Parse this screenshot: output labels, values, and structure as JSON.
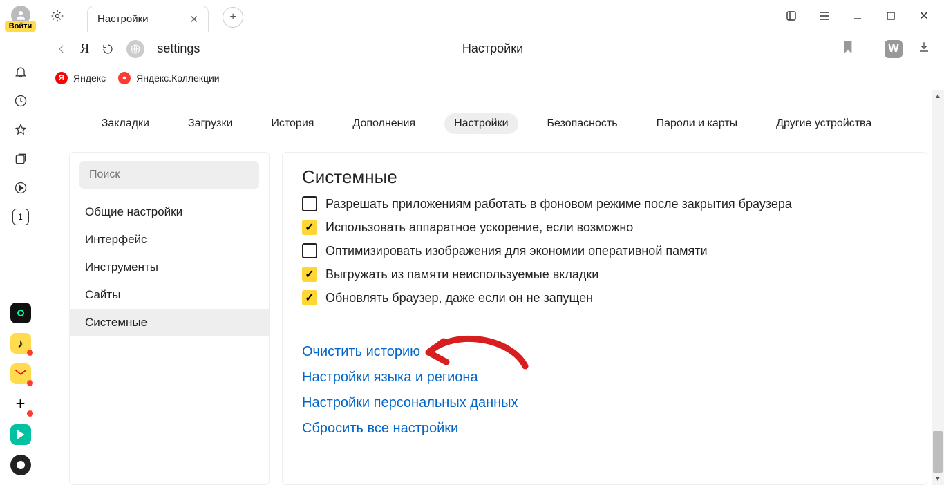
{
  "login_badge": "Войти",
  "sidebar_badge_num": "1",
  "tab": {
    "title": "Настройки"
  },
  "address": {
    "text": "settings",
    "title": "Настройки"
  },
  "favorites": [
    {
      "label": "Яндекс"
    },
    {
      "label": "Яндекс.Коллекции"
    }
  ],
  "nav_tabs": [
    "Закладки",
    "Загрузки",
    "История",
    "Дополнения",
    "Настройки",
    "Безопасность",
    "Пароли и карты",
    "Другие устройства"
  ],
  "nav_active_index": 4,
  "search_placeholder": "Поиск",
  "side_items": [
    "Общие настройки",
    "Интерфейс",
    "Инструменты",
    "Сайты",
    "Системные"
  ],
  "side_active_index": 4,
  "main": {
    "title": "Системные",
    "checkbox_cutoff": "Разрешать приложениям работать в фоновом режиме после закрытия браузера",
    "checkboxes": [
      {
        "label": "Использовать аппаратное ускорение, если возможно",
        "checked": true
      },
      {
        "label": "Оптимизировать изображения для экономии оперативной памяти",
        "checked": false
      },
      {
        "label": "Выгружать из памяти неиспользуемые вкладки",
        "checked": true
      },
      {
        "label": "Обновлять браузер, даже если он не запущен",
        "checked": true
      }
    ],
    "links": [
      "Очистить историю",
      "Настройки языка и региона",
      "Настройки персональных данных",
      "Сбросить все настройки"
    ]
  },
  "right_badge": "W"
}
